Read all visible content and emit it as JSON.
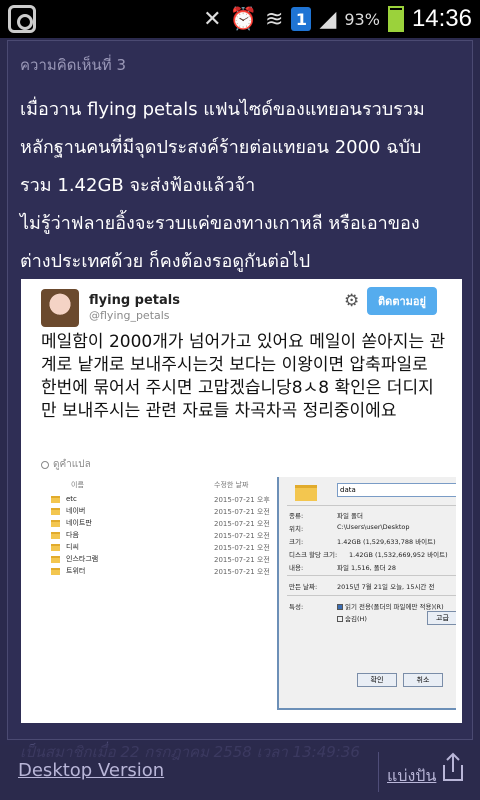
{
  "status_bar": {
    "time": "14:36",
    "battery_pct": "93%",
    "badge": "1",
    "icons": [
      "gallery-icon",
      "mute-icon",
      "alarm-icon",
      "wifi-icon",
      "notification-badge-icon",
      "signal-icon",
      "battery-icon"
    ]
  },
  "comment": {
    "label": "ความคิดเห็นที่ 3",
    "lines": [
      "เมื่อวาน flying petals แฟนไซด์ของแทยอนรวบรวม",
      "หลักฐานคนที่มีจุดประสงค์ร้ายต่อแทยอน 2000 ฉบับ",
      "รวม 1.42GB จะส่งฟ้องแล้วจ้า",
      "ไม่รู้ว่าฟลายอิ้งจะรวบแค่ของทางเกาหลี หรือเอาของ",
      "ต่างประเทศด้วย ก็คงต้องรอดูกันต่อไป"
    ]
  },
  "tweet": {
    "name": "flying petals",
    "handle": "@flying_petals",
    "follow_label": "ติดตามอยู่",
    "text": "메일함이 2000개가 넘어가고 있어요 메일이 쏟아지는 관계로 낱개로 보내주시는것 보다는 이왕이면 압축파일로 한번에 묶어서 주시면 고맙겠습니당8ㅅ8 확인은 더디지만 보내주시는 관련 자료들 차곡차곡 정리중이에요",
    "translate_label": "ดูคำแปล"
  },
  "screenshot": {
    "explorer": {
      "col_name": "이름",
      "col_date": "수정한 날짜",
      "rows": [
        {
          "name": "etc",
          "date": "2015-07-21 오후"
        },
        {
          "name": "네이버",
          "date": "2015-07-21 오전"
        },
        {
          "name": "네이트판",
          "date": "2015-07-21 오전"
        },
        {
          "name": "다음",
          "date": "2015-07-21 오전"
        },
        {
          "name": "디씨",
          "date": "2015-07-21 오전"
        },
        {
          "name": "인스타그램",
          "date": "2015-07-21 오전"
        },
        {
          "name": "트위터",
          "date": "2015-07-21 오전"
        }
      ]
    },
    "dialog": {
      "folder_name": "data",
      "type_label": "종류:",
      "type_value": "파일 폴더",
      "location_label": "위치:",
      "location_value": "C:\\Users\\user\\Desktop",
      "size_label": "크기:",
      "size_value": "1.42GB (1,529,633,788 바이트)",
      "disk_label": "디스크 할당 크기:",
      "disk_value": "1.42GB (1,532,669,952 바이트)",
      "contents_label": "내용:",
      "contents_value": "파일 1,516, 폴더 28",
      "created_label": "만든 날짜:",
      "created_value": "2015년 7월 21일 오늘, 15시간 전",
      "attr_label": "특성:",
      "readonly_label": "읽기 전용(폴더의 파일에만 적용)(R)",
      "hidden_label": "숨김(H)",
      "advanced_label": "고급",
      "ok_label": "확인",
      "cancel_label": "취소"
    }
  },
  "footer": {
    "meta": "เป็นสมาชิกเมื่อ 22 กรกฎาคม 2558 เวลา 13:49:36",
    "desktop_link": "Desktop Version",
    "share_label": "แบ่งปัน"
  }
}
